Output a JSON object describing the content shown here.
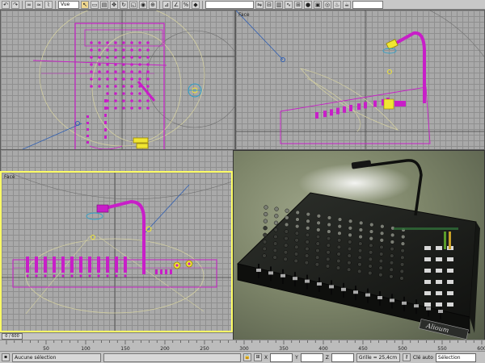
{
  "toolbar": {
    "view_select": "Vue",
    "icons": [
      "undo-icon",
      "redo-icon",
      "link-icon",
      "unlink-icon",
      "bind-icon",
      "select-icon",
      "select-region-icon",
      "filter-icon",
      "move-icon",
      "rotate-icon",
      "scale-icon",
      "coord-icon",
      "pivot-icon",
      "snap-icon",
      "angle-snap-icon",
      "percent-snap-icon",
      "mirror-icon",
      "align-icon",
      "layer-icon",
      "curve-icon",
      "schematic-icon",
      "material-icon",
      "render-setup-icon",
      "render-icon",
      "teapot-icon"
    ]
  },
  "viewports": {
    "top_label": "",
    "front_label": "Face",
    "left_label": "Face",
    "perspective_label": ""
  },
  "timeslider": {
    "position": "0 / 600"
  },
  "timeline": {
    "ticks": [
      "50",
      "100",
      "150",
      "200",
      "250",
      "300",
      "350",
      "400",
      "450",
      "500",
      "550",
      "600"
    ]
  },
  "status": {
    "selection": "Aucune sélection",
    "x_label": "X",
    "y_label": "Y",
    "z_label": "Z",
    "grid": "Grille = 25,4cm",
    "key_label": "Clé auto",
    "key_mode": "Sélection"
  },
  "product": {
    "brand": "Alioum"
  },
  "colors": {
    "magenta": "#c81ec8",
    "yellow": "#f0e632",
    "wire": "#dad6a8",
    "blue": "#2f5fb3"
  }
}
